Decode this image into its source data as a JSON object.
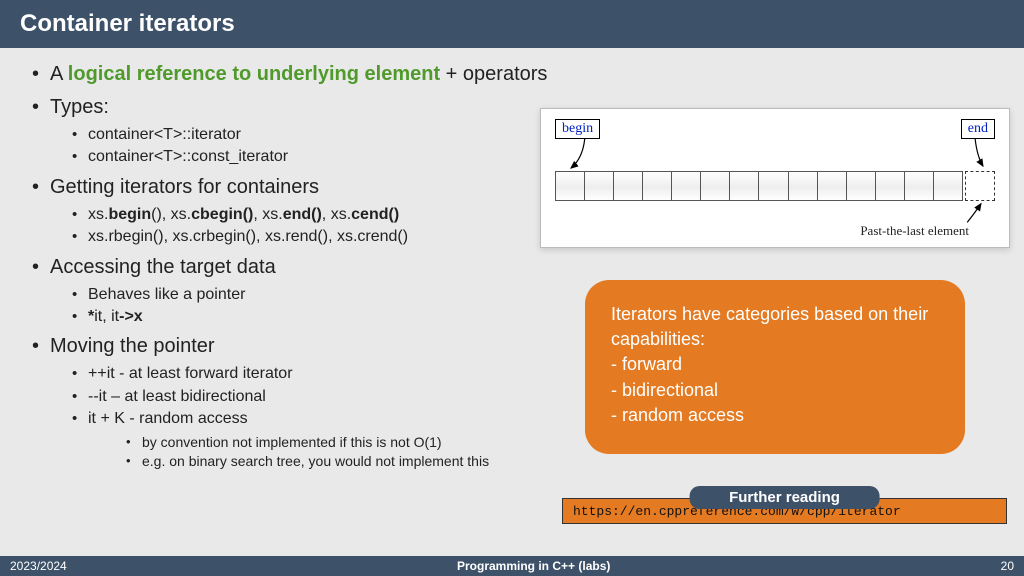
{
  "title": "Container iterators",
  "intro": {
    "prefix": "A ",
    "green": "logical reference to underlying element",
    "suffix": " + operators"
  },
  "types": {
    "heading": "Types:",
    "items": [
      "container<T>::iterator",
      "container<T>::const_iterator"
    ]
  },
  "getting": {
    "heading": "Getting iterators for containers",
    "row1": {
      "p0": "xs.",
      "b0": "begin",
      "p1": "(), xs.",
      "b1": "cbegin()",
      "p2": ", xs.",
      "b2": "end()",
      "p3": ", xs.",
      "b3": "cend()"
    },
    "row2": "xs.rbegin(), xs.crbegin(), xs.rend(), xs.crend()"
  },
  "access": {
    "heading": "Accessing the target data",
    "row1": "Behaves like a pointer",
    "row2": {
      "b0": "*",
      "p0": "it,  it",
      "b1": "->x"
    }
  },
  "moving": {
    "heading": "Moving the pointer",
    "r1": "++it  - at least forward iterator",
    "r2": "--it – at least bidirectional",
    "r3": "it + K -  random access",
    "notes": [
      "by convention not implemented if this is not O(1)",
      "e.g. on binary search tree, you would not implement this"
    ]
  },
  "diagram": {
    "begin": "begin",
    "end": "end",
    "past": "Past-the-last element"
  },
  "orange": {
    "l1": "Iterators have categories based on their capabilities:",
    "l2": "- forward",
    "l3": "- bidirectional",
    "l4": "- random access"
  },
  "further": {
    "label": "Further reading",
    "url": "https://en.cppreference.com/w/cpp/iterator"
  },
  "footer": {
    "left": "2023/2024",
    "center": "Programming in C++ (labs)",
    "right": "20"
  }
}
